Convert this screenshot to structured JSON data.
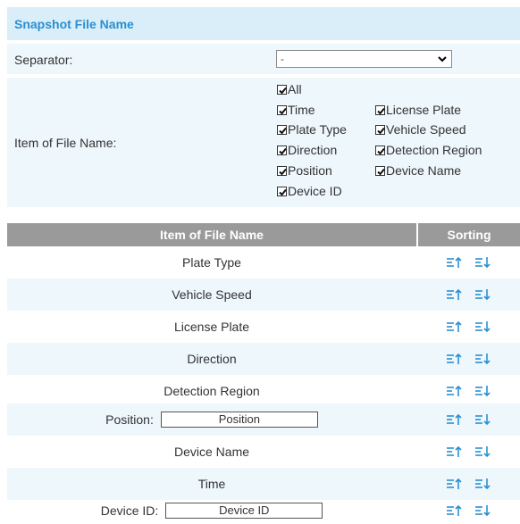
{
  "section": {
    "title": "Snapshot File Name"
  },
  "separator": {
    "label": "Separator:",
    "value": "-"
  },
  "items": {
    "label": "Item of File Name:",
    "checkboxes": {
      "all": "All",
      "time": "Time",
      "license_plate": "License Plate",
      "plate_type": "Plate Type",
      "vehicle_speed": "Vehicle Speed",
      "direction": "Direction",
      "detection_region": "Detection Region",
      "position": "Position",
      "device_name": "Device Name",
      "device_id": "Device ID"
    }
  },
  "table": {
    "headers": {
      "item": "Item of File Name",
      "sorting": "Sorting"
    },
    "rows": [
      {
        "label": "Plate Type"
      },
      {
        "label": "Vehicle Speed"
      },
      {
        "label": "License Plate"
      },
      {
        "label": "Direction"
      },
      {
        "label": "Detection Region"
      },
      {
        "label": "Position:",
        "input": "Position"
      },
      {
        "label": "Device Name"
      },
      {
        "label": "Time"
      },
      {
        "label": "Device ID:",
        "input": "Device ID"
      }
    ]
  },
  "colors": {
    "accent": "#2a8fd0",
    "header_bg": "#9a9a9a",
    "row_alt": "#eef7fc",
    "section_bg": "#d9eef8"
  },
  "icons": {
    "sort_up": "sort-up-icon",
    "sort_down": "sort-down-icon",
    "checkbox": "checkmark-icon",
    "dropdown": "chevron-down-icon"
  }
}
